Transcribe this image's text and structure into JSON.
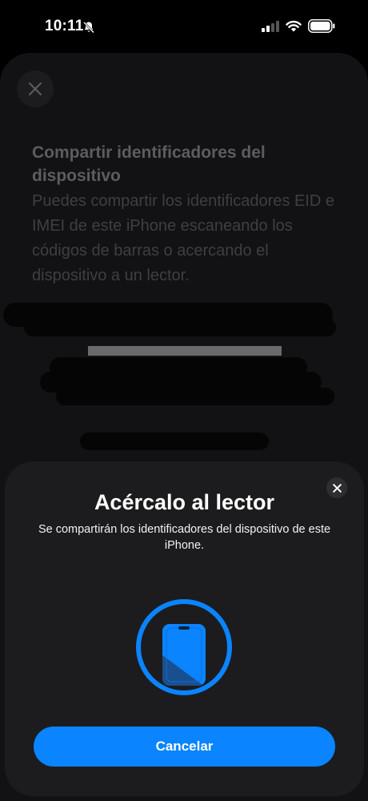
{
  "status_bar": {
    "time": "10:11",
    "icons": [
      "bell-slash-icon",
      "cellular-signal-icon",
      "wifi-icon",
      "battery-icon"
    ]
  },
  "background_screen": {
    "title": "Compartir identificadores del dispositivo",
    "description": "Puedes compartir los identificadores EID e IMEI de este iPhone escaneando los códigos de barras o acercando el dispositivo a un lector."
  },
  "sheet": {
    "title": "Acércalo al lector",
    "subtitle": "Se compartirán los identificadores del dispositivo de este iPhone.",
    "cancel_label": "Cancelar"
  },
  "colors": {
    "accent": "#0a84ff",
    "sheet_background": "#1c1c1e",
    "page_background": "#121214"
  }
}
